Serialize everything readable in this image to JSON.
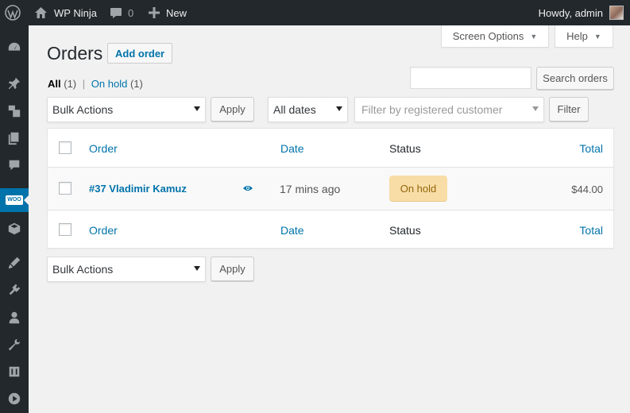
{
  "adminbar": {
    "site_name": "WP Ninja",
    "comments_count": "0",
    "new_label": "New",
    "howdy": "Howdy, admin"
  },
  "sidebar": {
    "items": [
      {
        "icon": "dashboard-icon"
      },
      {
        "icon": "pin-icon"
      },
      {
        "icon": "media-icon"
      },
      {
        "icon": "pages-icon"
      },
      {
        "icon": "comments-icon"
      },
      {
        "icon": "woocommerce-icon",
        "label": "WOO",
        "active": true
      },
      {
        "icon": "products-icon"
      },
      {
        "icon": "appearance-icon"
      },
      {
        "icon": "plugins-icon"
      },
      {
        "icon": "users-icon"
      },
      {
        "icon": "tools-icon"
      },
      {
        "icon": "settings-icon"
      },
      {
        "icon": "media-player-icon"
      }
    ]
  },
  "screen_meta": {
    "screen_options": "Screen Options",
    "help": "Help"
  },
  "page": {
    "title": "Orders",
    "add_button": "Add order"
  },
  "views": {
    "all_label": "All",
    "all_count": "(1)",
    "separator": "|",
    "on_hold_label": "On hold",
    "on_hold_count": "(1)"
  },
  "search": {
    "value": "",
    "button": "Search orders"
  },
  "filters": {
    "bulk_actions": "Bulk Actions",
    "apply": "Apply",
    "dates": "All dates",
    "customer_placeholder": "Filter by registered customer",
    "filter_button": "Filter"
  },
  "table": {
    "columns": {
      "order": "Order",
      "date": "Date",
      "status": "Status",
      "total": "Total"
    },
    "rows": [
      {
        "order": "#37 Vladimir Kamuz",
        "date": "17 mins ago",
        "status": "On hold",
        "total": "$44.00"
      }
    ]
  },
  "colors": {
    "admin_bar": "#23282d",
    "accent": "#0073aa",
    "status_on_hold_bg": "#f8dda7",
    "status_on_hold_text": "#94660c"
  }
}
